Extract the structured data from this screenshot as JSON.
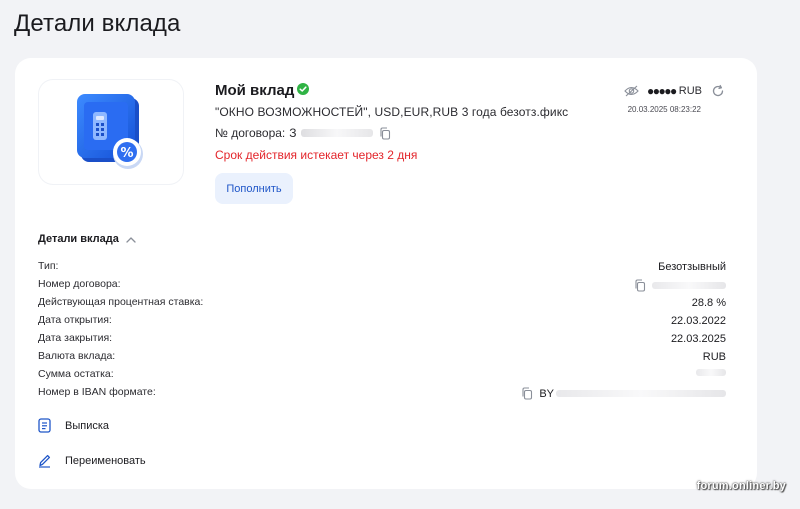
{
  "page": {
    "title": "Детали вклада"
  },
  "deposit": {
    "name": "Мой вклад",
    "product": "\"ОКНО ВОЗМОЖНОСТЕЙ\", USD,EUR,RUB 3 года безотз.фикс",
    "contract_label": "№ договора:",
    "contract_value_visible": "З",
    "expiry_warning": "Срок действия истекает через 2 дня",
    "topup_label": "Пополнить"
  },
  "balance": {
    "masked": "●●●●●",
    "currency": "RUB",
    "timestamp": "20.03.2025 08:23:22"
  },
  "details": {
    "section_title": "Детали вклада",
    "rows": [
      {
        "label": "Тип:",
        "value": "Безотзывный"
      },
      {
        "label": "Номер договора:",
        "value": ""
      },
      {
        "label": "Действующая процентная ставка:",
        "value": "28.8 %"
      },
      {
        "label": "Дата открытия:",
        "value": "22.03.2022"
      },
      {
        "label": "Дата закрытия:",
        "value": "22.03.2025"
      },
      {
        "label": "Валюта вклада:",
        "value": "RUB"
      },
      {
        "label": "Сумма остатка:",
        "value": ""
      },
      {
        "label": "Номер в IBAN формате:",
        "value": "BY"
      }
    ]
  },
  "actions": {
    "statement": "Выписка",
    "rename": "Переименовать"
  },
  "watermark": "forum.onliner.by",
  "colors": {
    "accent": "#1f56c8",
    "warning": "#e3252b",
    "success": "#2fb344",
    "background": "#f2f3f6"
  }
}
